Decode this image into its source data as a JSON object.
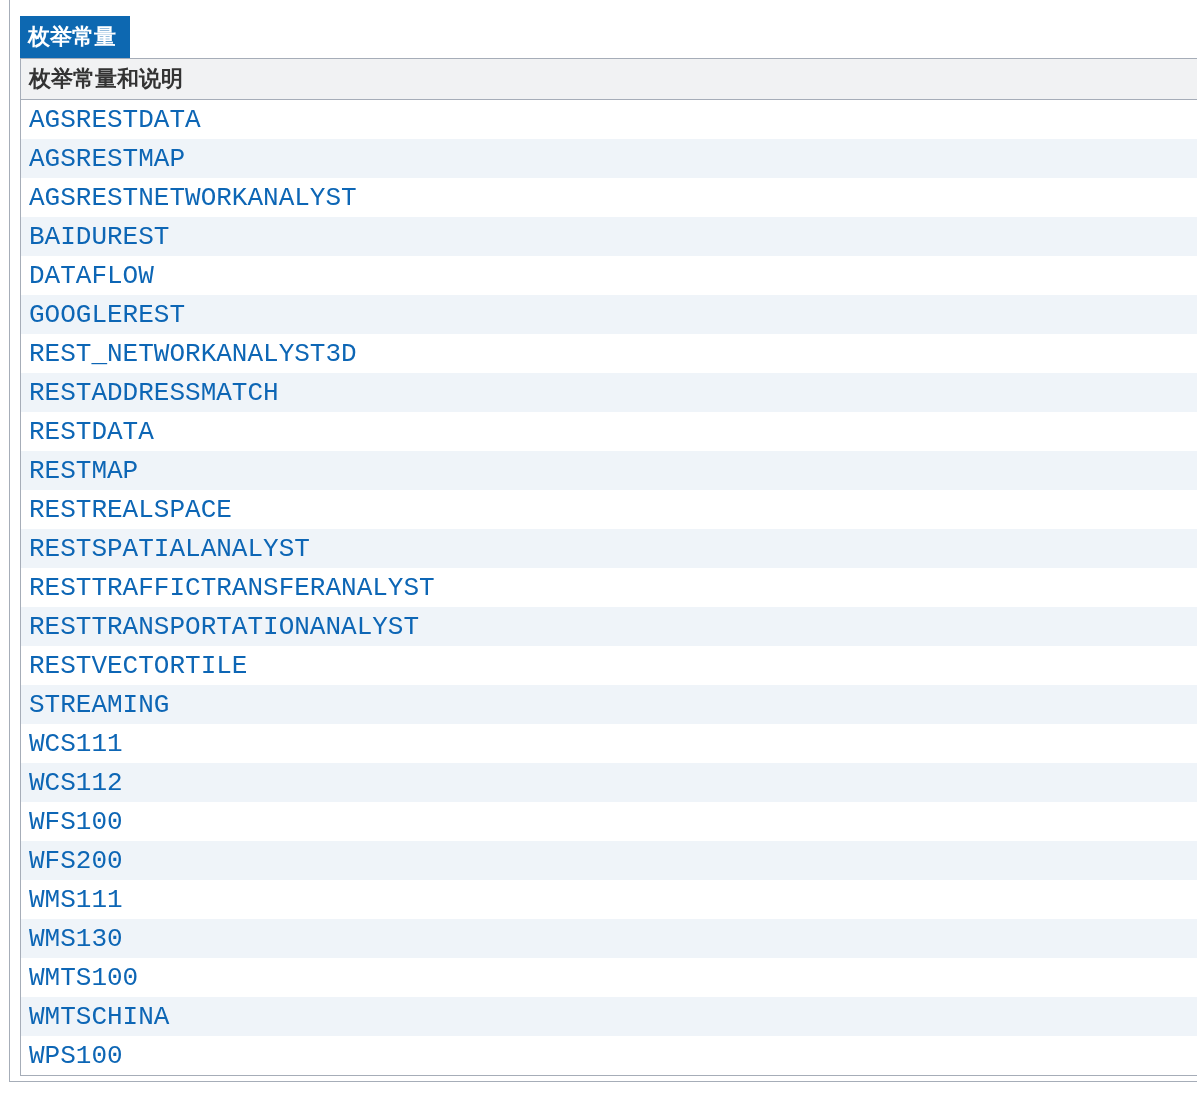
{
  "caption": "枚举常量",
  "table": {
    "columns": [
      "枚举常量和说明"
    ],
    "rows": [
      "AGSRESTDATA",
      "AGSRESTMAP",
      "AGSRESTNETWORKANALYST",
      "BAIDUREST",
      "DATAFLOW",
      "GOOGLEREST",
      "REST_NETWORKANALYST3D",
      "RESTADDRESSMATCH",
      "RESTDATA",
      "RESTMAP",
      "RESTREALSPACE",
      "RESTSPATIALANALYST",
      "RESTTRAFFICTRANSFERANALYST",
      "RESTTRANSPORTATIONANALYST",
      "RESTVECTORTILE",
      "STREAMING",
      "WCS111",
      "WCS112",
      "WFS100",
      "WFS200",
      "WMS111",
      "WMS130",
      "WMTS100",
      "WMTSCHINA",
      "WPS100"
    ]
  }
}
